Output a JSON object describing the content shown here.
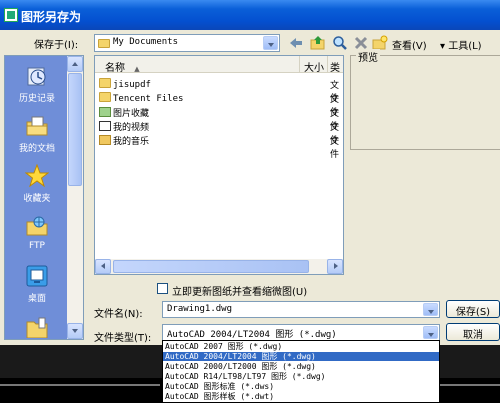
{
  "window": {
    "title": "图形另存为"
  },
  "toolbar": {
    "save_in_label": "保存于(I):",
    "location_value": "My Documents",
    "views_label": "查看(V)",
    "tools_label": "▾ 工具(L)"
  },
  "places": {
    "items": [
      {
        "label": "历史记录",
        "icon": "history-icon"
      },
      {
        "label": "我的文档",
        "icon": "my-documents-icon"
      },
      {
        "label": "收藏夹",
        "icon": "favorites-icon"
      },
      {
        "label": "FTP",
        "icon": "ftp-icon"
      },
      {
        "label": "桌面",
        "icon": "desktop-icon"
      }
    ]
  },
  "filelist": {
    "columns": [
      "名称",
      "大小",
      "类"
    ],
    "rows": [
      {
        "name": "jisupdf",
        "type": "文件",
        "icon": "folder-icon"
      },
      {
        "name": "Tencent Files",
        "type": "文件",
        "icon": "folder-icon"
      },
      {
        "name": "图片收藏",
        "type": "文件",
        "icon": "pictures-folder-icon"
      },
      {
        "name": "我的视频",
        "type": "文件",
        "icon": "videos-folder-icon"
      },
      {
        "name": "我的音乐",
        "type": "文件",
        "icon": "music-folder-icon"
      }
    ]
  },
  "preview": {
    "label": "预览"
  },
  "options": {
    "update_thumbnail_label": "立即更新图纸并查看缩微图(U)"
  },
  "filename": {
    "label": "文件名(N):",
    "value": "Drawing1.dwg"
  },
  "filetype": {
    "label": "文件类型(T):",
    "value": "AutoCAD 2004/LT2004 图形 (*.dwg)",
    "options": [
      "AutoCAD 2007 图形 (*.dwg)",
      "AutoCAD 2004/LT2004 图形 (*.dwg)",
      "AutoCAD 2000/LT2000 图形 (*.dwg)",
      "AutoCAD R14/LT98/LT97 图形 (*.dwg)",
      "AutoCAD 图形标准 (*.dws)",
      "AutoCAD 图形样板 (*.dwt)"
    ],
    "selected_index": 1
  },
  "buttons": {
    "save": "保存(S)",
    "cancel": "取消"
  },
  "colors": {
    "titlebar": "#0450d0",
    "places_bg": "#6f8ed8",
    "selection": "#316ac5"
  }
}
